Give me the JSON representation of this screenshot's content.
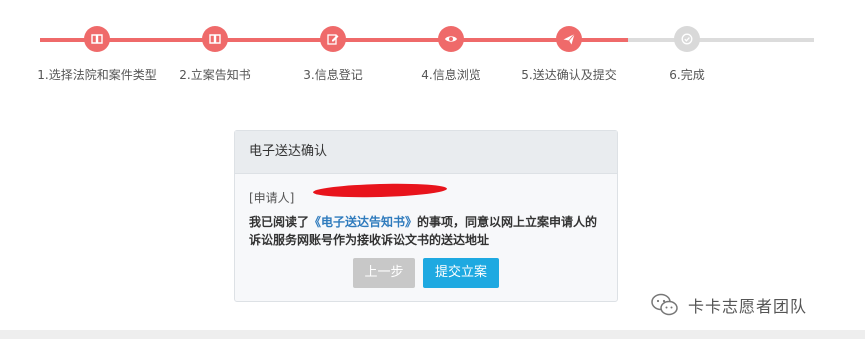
{
  "steps": [
    {
      "label": "1.选择法院和案件类型",
      "icon": "book-icon",
      "state": "done"
    },
    {
      "label": "2.立案告知书",
      "icon": "book-icon",
      "state": "done"
    },
    {
      "label": "3.信息登记",
      "icon": "edit-icon",
      "state": "done"
    },
    {
      "label": "4.信息浏览",
      "icon": "eye-icon",
      "state": "done"
    },
    {
      "label": "5.送达确认及提交",
      "icon": "send-icon",
      "state": "current"
    },
    {
      "label": "6.完成",
      "icon": "check-icon",
      "state": "pending"
    }
  ],
  "colors": {
    "active": "#ef6a6a",
    "pending": "#d9d9d9",
    "link": "#2f7bbd",
    "submit": "#1ea9e1"
  },
  "panel": {
    "title": "电子送达确认",
    "applicant_prefix": "[申请人]",
    "agree_before": "我已阅读了",
    "agree_link": "《电子送达告知书》",
    "agree_after": "的事项，同意以网上立案申请人的诉讼服务网账号作为接收诉讼文书的送达地址",
    "prev_button": "上一步",
    "submit_button": "提交立案"
  },
  "watermark": {
    "text": "卡卡志愿者团队",
    "icon": "wechat-icon"
  }
}
